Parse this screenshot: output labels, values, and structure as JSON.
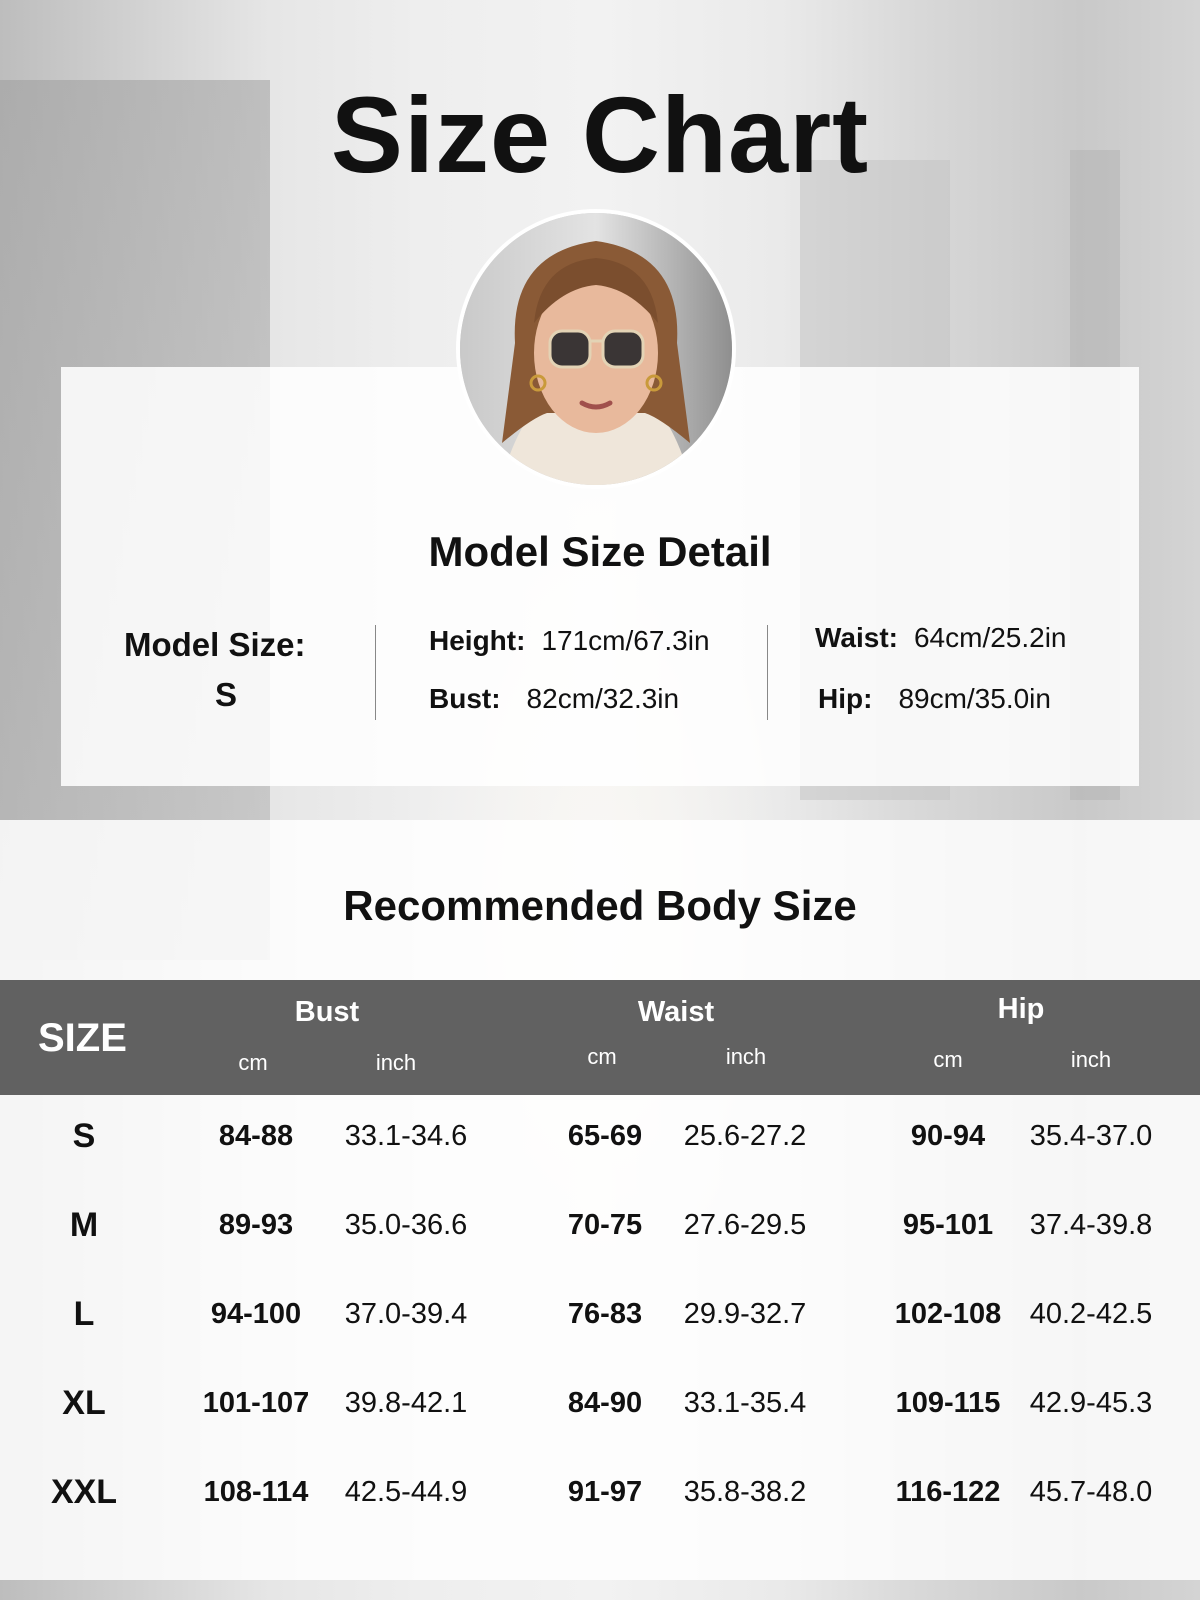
{
  "title": "Size Chart",
  "model": {
    "section_title": "Model Size Detail",
    "size_label": "Model Size:",
    "size_value": "S",
    "height_label": "Height:",
    "height_value": "171cm/67.3in",
    "bust_label": "Bust:",
    "bust_value": "82cm/32.3in",
    "waist_label": "Waist:",
    "waist_value": "64cm/25.2in",
    "hip_label": "Hip:",
    "hip_value": "89cm/35.0in"
  },
  "recommended": {
    "section_title": "Recommended Body Size",
    "header": {
      "size": "SIZE",
      "groups": [
        "Bust",
        "Waist",
        "Hip"
      ],
      "units": [
        "cm",
        "inch",
        "cm",
        "inch",
        "cm",
        "inch"
      ]
    },
    "rows": [
      [
        "S",
        "84-88",
        "33.1-34.6",
        "65-69",
        "25.6-27.2",
        "90-94",
        "35.4-37.0"
      ],
      [
        "M",
        "89-93",
        "35.0-36.6",
        "70-75",
        "27.6-29.5",
        "95-101",
        "37.4-39.8"
      ],
      [
        "L",
        "94-100",
        "37.0-39.4",
        "76-83",
        "29.9-32.7",
        "102-108",
        "40.2-42.5"
      ],
      [
        "XL",
        "101-107",
        "39.8-42.1",
        "84-90",
        "33.1-35.4",
        "109-115",
        "42.9-45.3"
      ],
      [
        "XXL",
        "108-114",
        "42.5-44.9",
        "91-97",
        "35.8-38.2",
        "116-122",
        "45.7-48.0"
      ]
    ]
  }
}
